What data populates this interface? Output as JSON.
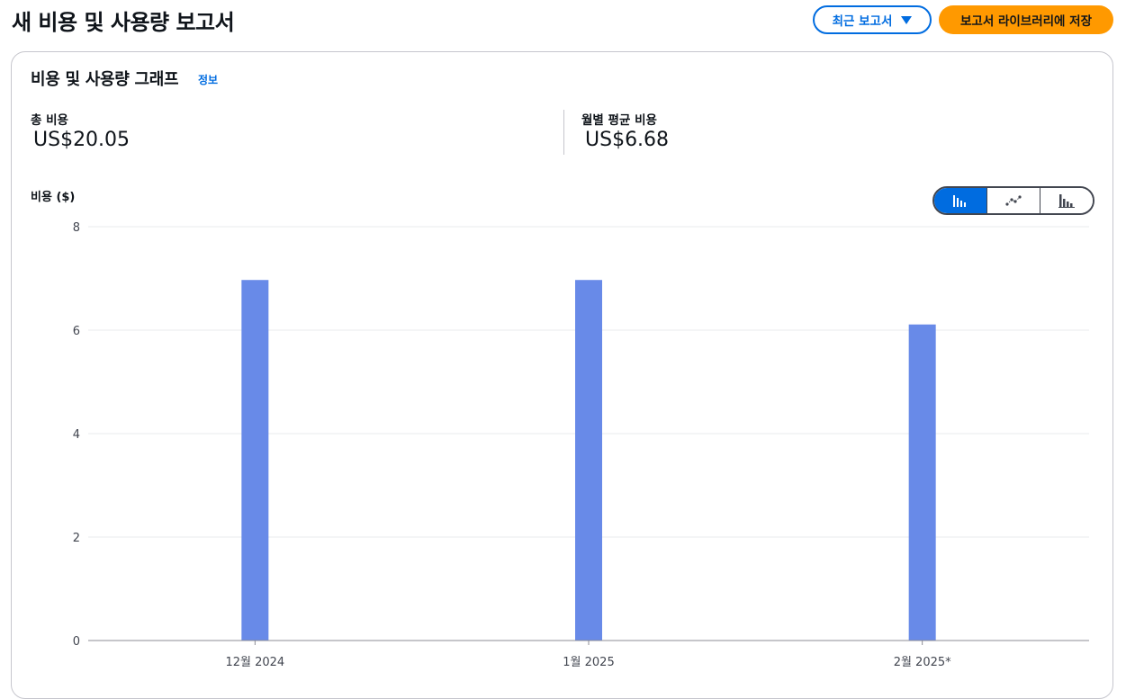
{
  "header": {
    "title": "새 비용 및 사용량 보고서",
    "recent_reports_label": "최근 보고서",
    "save_label": "보고서 라이브러리에 저장"
  },
  "card": {
    "title": "비용 및 사용량 그래프",
    "info_link": "정보",
    "total_cost_label": "총 비용",
    "total_cost_value": "US$20.05",
    "monthly_avg_label": "월별 평균 비용",
    "monthly_avg_value": "US$6.68"
  },
  "chart_toggle": {
    "options": [
      "bar-chart-icon",
      "line-chart-icon",
      "stacked-bar-chart-icon"
    ],
    "active": "bar-chart-icon"
  },
  "colors": {
    "accent": "#006ce0",
    "save_button": "#ff9900",
    "bar": "#688ae8"
  },
  "chart_data": {
    "type": "bar",
    "ylabel": "비용 ($)",
    "categories": [
      "12월 2024",
      "1월 2025",
      "2월 2025*"
    ],
    "values": [
      6.97,
      6.97,
      6.11
    ],
    "ylim": [
      0,
      8
    ],
    "yticks": [
      0,
      2,
      4,
      6,
      8
    ],
    "grid": true
  }
}
